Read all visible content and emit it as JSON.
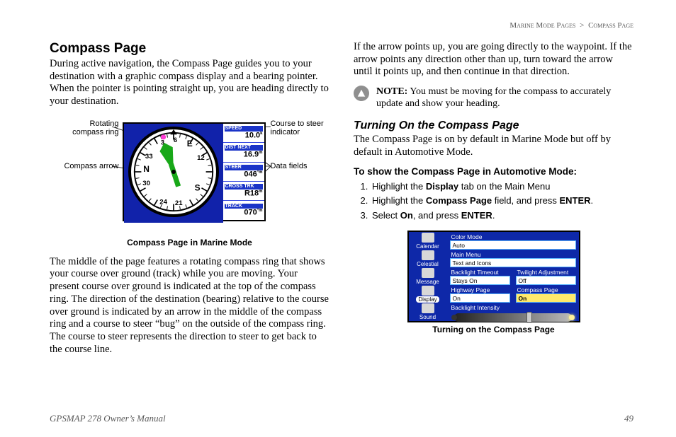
{
  "breadcrumb": {
    "a": "Marine Mode Pages",
    "sep": ">",
    "b": "Compass Page"
  },
  "heading": "Compass Page",
  "p1": "During active navigation, the Compass Page guides you to your destination with a graphic compass display and a bearing pointer. When the pointer is pointing straight up, you are heading directly to your destination.",
  "annot": {
    "rotating": "Rotating compass ring",
    "arrow": "Compass arrow",
    "cts": "Course to steer indicator",
    "data": "Data fields"
  },
  "compass_ticks": {
    "n": "N",
    "e": "E",
    "s": "S",
    "t3": "3",
    "t6": "6",
    "t12": "12",
    "t21": "21",
    "t24": "24",
    "t30": "30",
    "t33": "33"
  },
  "datafields": [
    {
      "label": "SPEED",
      "value": "10.0",
      "unit": "k"
    },
    {
      "label": "DIST NEXT",
      "value": "16.9",
      "unit": "m"
    },
    {
      "label": "STEER",
      "value": "046",
      "unit": "°m"
    },
    {
      "label": "CROSS TRK",
      "value": "R18",
      "unit": "m"
    },
    {
      "label": "TRACK",
      "value": "070",
      "unit": "°m"
    }
  ],
  "fig1_caption": "Compass Page in Marine Mode",
  "p2": "The middle of the page features a rotating compass ring that shows your course over ground (track) while you are moving. Your present course over ground is indicated at the top of the compass ring. The direction of the destination (bearing) relative to the course over ground is indicated by an arrow in the middle of the compass ring and a course to steer “bug” on the outside of the compass ring. The course to steer represents the direction to steer to get back to the course line.",
  "p3": "If the arrow points up, you are going directly to the waypoint. If the arrow points any direction other than up, turn toward the arrow until it points up, and then continue in that direction.",
  "note_label": "NOTE:",
  "note_body": " You must be moving for the compass to accurately update and show your heading.",
  "sub_heading": "Turning On the Compass Page",
  "p4": "The Compass Page is on by default in Marine Mode but off by default in Automotive Mode.",
  "instr_head": "To show the Compass Page in Automotive Mode:",
  "steps_text": {
    "s1a": "Highlight the ",
    "s1b": "Display",
    "s1c": " tab on the Main Menu",
    "s2a": "Highlight the ",
    "s2b": "Compass Page",
    "s2c": " field, and press ",
    "s2d": "ENTER",
    "s2e": ".",
    "s3a": "Select ",
    "s3b": "On",
    "s3c": ", and press ",
    "s3d": "ENTER",
    "s3e": "."
  },
  "menu": {
    "tabs": [
      "Calendar",
      "Celestial",
      "Message",
      "Display",
      "Sound"
    ],
    "active_tab": "Display",
    "labels": {
      "color_mode": "Color Mode",
      "main_menu": "Main Menu",
      "backlight_timeout": "Backlight Timeout",
      "twilight": "Twilight Adjustment",
      "hwy": "Highway Page",
      "compass": "Compass Page",
      "backlight_intensity": "Backlight Intensity"
    },
    "values": {
      "color_mode": "Auto",
      "main_menu": "Text and Icons",
      "backlight_timeout": "Stays On",
      "twilight": "Off",
      "hwy": "On",
      "compass": "On"
    }
  },
  "fig2_caption": "Turning on the Compass Page",
  "footer": {
    "manual": "GPSMAP 278 Owner’s Manual",
    "page": "49"
  }
}
